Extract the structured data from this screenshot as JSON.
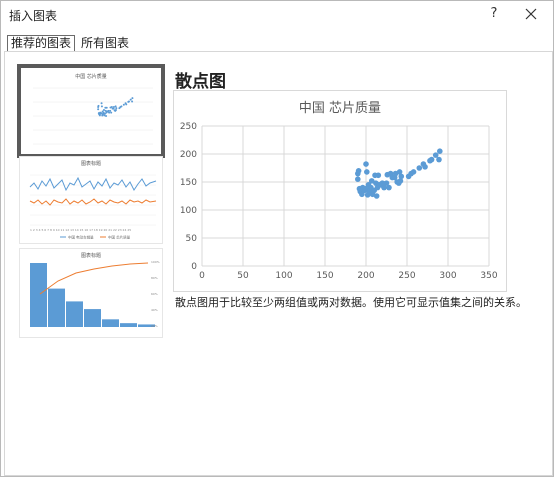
{
  "window": {
    "title": "插入图表",
    "help_label": "?"
  },
  "tabs": [
    {
      "label": "推荐的图表",
      "active": true
    },
    {
      "label": "所有图表",
      "active": false
    }
  ],
  "thumbnails": [
    {
      "title": "中国 芯片质量",
      "kind": "scatter",
      "selected": true
    },
    {
      "title": "图表标题",
      "kind": "line",
      "selected": false
    },
    {
      "title": "图表标题",
      "kind": "pareto",
      "selected": false
    }
  ],
  "preview": {
    "heading": "散点图",
    "description": "散点图用于比较至少两组值或两对数据。使用它可显示值集之间的关系。"
  },
  "colors": {
    "series": "#5b9bd5",
    "line2": "#ed7d31"
  },
  "chart_data": {
    "type": "scatter",
    "title": "中国 芯片质量",
    "xlim": [
      0,
      350
    ],
    "ylim": [
      0,
      250
    ],
    "xticks": [
      "0",
      "50",
      "100",
      "150",
      "200",
      "250",
      "300",
      "350"
    ],
    "yticks": [
      "0",
      "50",
      "100",
      "150",
      "200",
      "250"
    ],
    "grid": true,
    "points": [
      [
        190,
        165
      ],
      [
        191,
        170
      ],
      [
        190,
        155
      ],
      [
        192,
        138
      ],
      [
        193,
        133
      ],
      [
        195,
        128
      ],
      [
        196,
        140
      ],
      [
        198,
        135
      ],
      [
        199,
        138
      ],
      [
        200,
        182
      ],
      [
        201,
        168
      ],
      [
        202,
        127
      ],
      [
        203,
        145
      ],
      [
        204,
        133
      ],
      [
        205,
        138
      ],
      [
        206,
        140
      ],
      [
        207,
        152
      ],
      [
        208,
        128
      ],
      [
        210,
        135
      ],
      [
        211,
        162
      ],
      [
        212,
        148
      ],
      [
        213,
        125
      ],
      [
        214,
        140
      ],
      [
        215,
        162
      ],
      [
        216,
        145
      ],
      [
        218,
        145
      ],
      [
        220,
        148
      ],
      [
        222,
        140
      ],
      [
        225,
        148
      ],
      [
        226,
        163
      ],
      [
        228,
        140
      ],
      [
        230,
        165
      ],
      [
        232,
        158
      ],
      [
        235,
        158
      ],
      [
        236,
        165
      ],
      [
        238,
        150
      ],
      [
        240,
        148
      ],
      [
        241,
        168
      ],
      [
        242,
        152
      ],
      [
        243,
        160
      ],
      [
        252,
        160
      ],
      [
        255,
        165
      ],
      [
        258,
        168
      ],
      [
        265,
        175
      ],
      [
        270,
        182
      ],
      [
        272,
        177
      ],
      [
        278,
        188
      ],
      [
        280,
        190
      ],
      [
        285,
        198
      ],
      [
        289,
        190
      ],
      [
        290,
        205
      ]
    ]
  },
  "thumb_line_data": {
    "legend": [
      "中国 电动车销量",
      "中国 芯片质量"
    ]
  },
  "thumb_pareto_data": {
    "bars": [
      100,
      60,
      40,
      28,
      12,
      6,
      4
    ]
  }
}
